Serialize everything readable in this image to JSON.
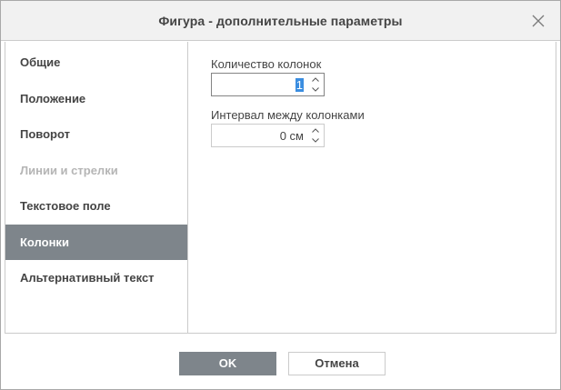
{
  "dialog": {
    "title": "Фигура - дополнительные параметры"
  },
  "sidebar": {
    "items": [
      {
        "label": "Общие",
        "state": "normal"
      },
      {
        "label": "Положение",
        "state": "normal"
      },
      {
        "label": "Поворот",
        "state": "normal"
      },
      {
        "label": "Линии и стрелки",
        "state": "disabled"
      },
      {
        "label": "Текстовое поле",
        "state": "normal"
      },
      {
        "label": "Колонки",
        "state": "active"
      },
      {
        "label": "Альтернативный текст",
        "state": "normal"
      }
    ]
  },
  "columns": {
    "count_label": "Количество колонок",
    "count_value": "1",
    "spacing_label": "Интервал между колонками",
    "spacing_value": "0 см"
  },
  "footer": {
    "ok_label": "OK",
    "cancel_label": "Отмена"
  },
  "colors": {
    "accent": "#7e858b",
    "selection": "#3a8de0",
    "titlebar": "#f1f1f1",
    "border": "#cbcbcb"
  },
  "icons": {
    "close": "close-icon",
    "up": "chevron-up-icon",
    "down": "chevron-down-icon"
  }
}
